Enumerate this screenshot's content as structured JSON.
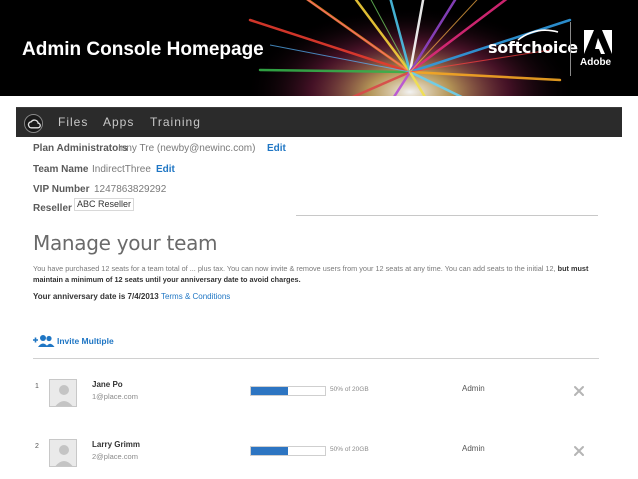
{
  "banner": {
    "title": "Admin Console Homepage",
    "partner_logo_text": "softchoice",
    "adobe_logo_text": "Adobe"
  },
  "navbar": {
    "items": [
      {
        "label": "Files"
      },
      {
        "label": "Apps"
      },
      {
        "label": "Training"
      }
    ]
  },
  "info": {
    "plan_admins_label": "Plan Administrators",
    "plan_admins_value": "Inny Tre (newby@newinc.com)",
    "team_name_label": "Team Name",
    "team_name_value": "IndirectThree",
    "vip_label": "VIP Number",
    "vip_value": "1247863829292",
    "reseller_label": "Reseller",
    "reseller_tooltip": "ABC Reseller",
    "edit_label": "Edit"
  },
  "manage": {
    "title": "Manage your team",
    "description_plain": "You have purchased 12 seats for a team total of ... plus tax. You can now invite & remove users from your 12 seats at any time. You can add seats to the initial 12,",
    "description_bold": "but must maintain a minimum of 12 seats until your anniversary date to avoid charges.",
    "anniversary_text": "Your anniversary date is 7/4/2013",
    "terms_link": "Terms & Conditions",
    "invite_label": "Invite Multiple"
  },
  "members": [
    {
      "num": "1",
      "name": "Jane Po",
      "email": "1@place.com",
      "usage_percent": 50,
      "usage_text": "50% of 20GB",
      "role": "Admin"
    },
    {
      "num": "2",
      "name": "Larry Grimm",
      "email": "2@place.com",
      "usage_percent": 50,
      "usage_text": "50% of 20GB",
      "role": "Admin"
    }
  ],
  "colors": {
    "link": "#1f76c4",
    "progress": "#2d75c2",
    "navbar": "#2b2b2b"
  },
  "icons": {
    "app_logo": "creative-cloud-icon",
    "invite": "users-plus-icon",
    "remove": "close-icon",
    "avatar": "user-silhouette-icon"
  }
}
